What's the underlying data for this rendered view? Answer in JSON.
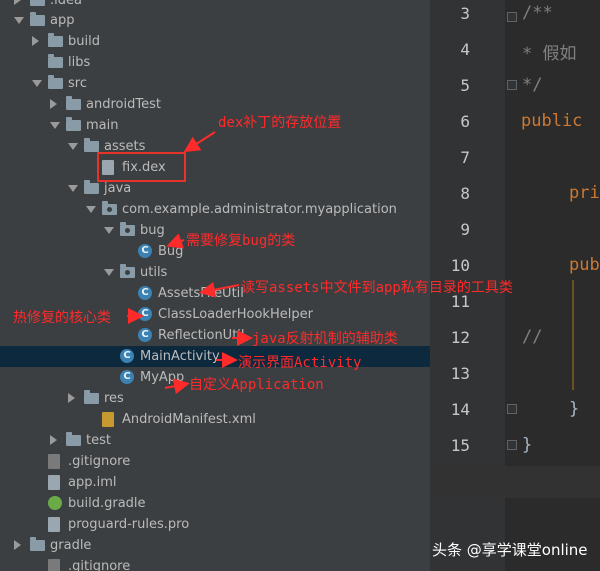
{
  "tree": [
    {
      "label": ".idea",
      "kind": "folder",
      "arrow": "right"
    },
    {
      "label": "app",
      "kind": "folder",
      "arrow": "down"
    },
    {
      "label": "build",
      "kind": "folder",
      "arrow": "right"
    },
    {
      "label": "libs",
      "kind": "folder",
      "arrow": ""
    },
    {
      "label": "src",
      "kind": "folder",
      "arrow": "down"
    },
    {
      "label": "androidTest",
      "kind": "folder",
      "arrow": "right"
    },
    {
      "label": "main",
      "kind": "folder",
      "arrow": "down"
    },
    {
      "label": "assets",
      "kind": "folder",
      "arrow": "down"
    },
    {
      "label": "fix.dex",
      "kind": "file",
      "arrow": ""
    },
    {
      "label": "java",
      "kind": "folder",
      "arrow": "down"
    },
    {
      "label": "com.example.administrator.myapplication",
      "kind": "package",
      "arrow": "down"
    },
    {
      "label": "bug",
      "kind": "package",
      "arrow": "down"
    },
    {
      "label": "Bug",
      "kind": "class",
      "arrow": ""
    },
    {
      "label": "utils",
      "kind": "package",
      "arrow": "down"
    },
    {
      "label": "AssetsFileUtil",
      "kind": "class",
      "arrow": ""
    },
    {
      "label": "ClassLoaderHookHelper",
      "kind": "class",
      "arrow": ""
    },
    {
      "label": "ReflectionUtil",
      "kind": "class",
      "arrow": ""
    },
    {
      "label": "MainActivity",
      "kind": "class",
      "arrow": ""
    },
    {
      "label": "MyApp",
      "kind": "class",
      "arrow": ""
    },
    {
      "label": "res",
      "kind": "folder",
      "arrow": "right"
    },
    {
      "label": "AndroidManifest.xml",
      "kind": "xml",
      "arrow": ""
    },
    {
      "label": "test",
      "kind": "folder",
      "arrow": "right"
    },
    {
      "label": ".gitignore",
      "kind": "git",
      "arrow": ""
    },
    {
      "label": "app.iml",
      "kind": "file",
      "arrow": ""
    },
    {
      "label": "build.gradle",
      "kind": "gradle",
      "arrow": ""
    },
    {
      "label": "proguard-rules.pro",
      "kind": "file",
      "arrow": ""
    },
    {
      "label": "gradle",
      "kind": "folder",
      "arrow": "right"
    },
    {
      "label": ".gitignore",
      "kind": "git",
      "arrow": ""
    }
  ],
  "class_icon_letter": "C",
  "editor": {
    "line_numbers": [
      "3",
      "4",
      "5",
      "6",
      "7",
      "8",
      "9",
      "10",
      "11",
      "12",
      "13",
      "14",
      "15",
      "16"
    ],
    "lines": [
      "/**",
      " * 假如",
      " */",
      "public",
      "",
      "pri",
      "",
      "pub",
      "",
      "//",
      "",
      "}",
      "}",
      ""
    ]
  },
  "annotations": {
    "dex_location": "dex补丁的存放位置",
    "bug_class": "需要修复bug的类",
    "assets_util": "读写assets中文件到app私有目录的工具类",
    "hotfix_core": "热修复的核心类",
    "reflection": "java反射机制的辅助类",
    "demo_activity": "演示界面Activity",
    "custom_app": "自定义Application"
  },
  "watermark": "头条 @享学课堂online",
  "colors": {
    "annotation": "#ff2a2a",
    "selection": "#0d293e",
    "class_icon": "#3b82b3",
    "comment": "#808080",
    "keyword": "#cc7832"
  }
}
